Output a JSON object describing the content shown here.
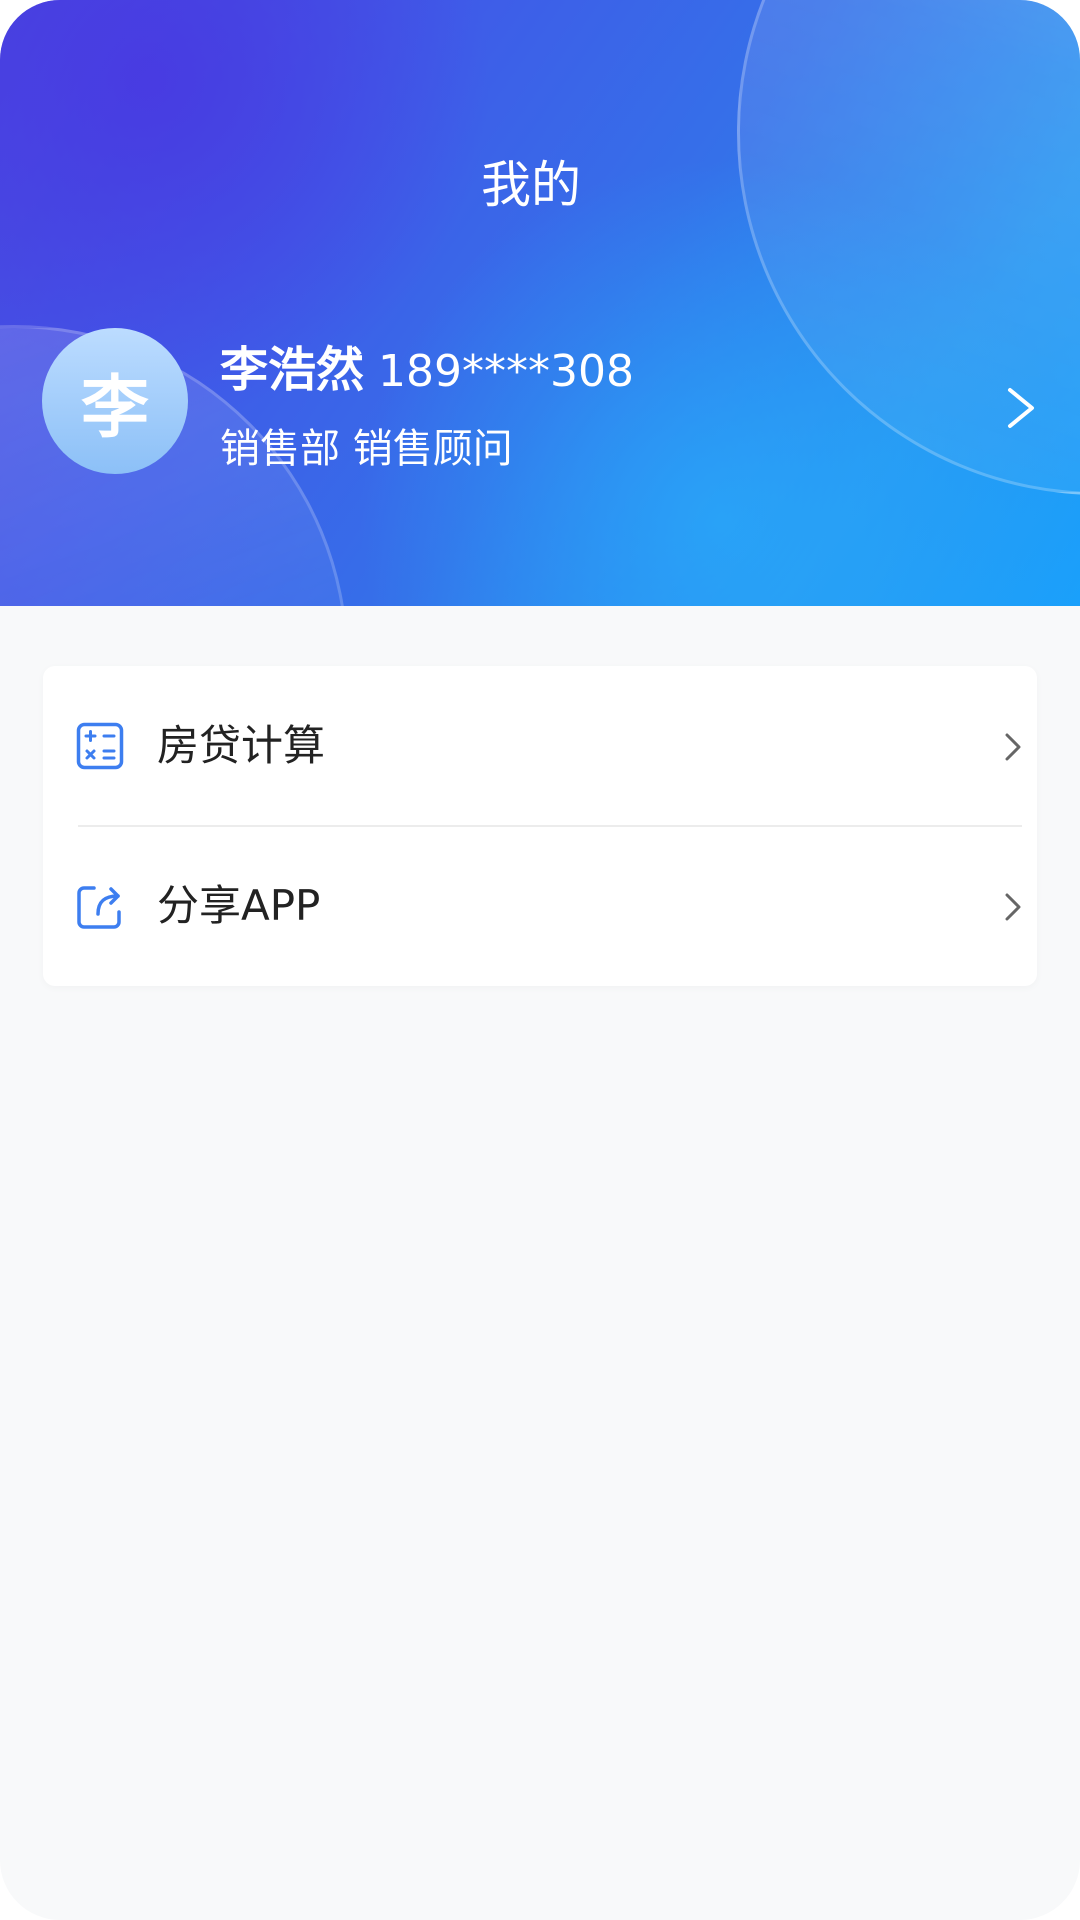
{
  "header": {
    "title": "我的"
  },
  "profile": {
    "avatar_initial": "李",
    "name": "李浩然",
    "phone": "189****308",
    "department": "销售部",
    "position": "销售顾问",
    "chevron_icon": "chevron-right-icon"
  },
  "menu": {
    "items": [
      {
        "label": "房贷计算",
        "icon": "calculator-icon"
      },
      {
        "label": "分享APP",
        "icon": "share-icon"
      }
    ]
  },
  "colors": {
    "header_gradient_start": "#4a45e0",
    "header_gradient_end": "#1aa0fb",
    "page_background": "#f8f9fa",
    "icon_accent": "#3d7ef0",
    "text_primary": "#222222"
  }
}
